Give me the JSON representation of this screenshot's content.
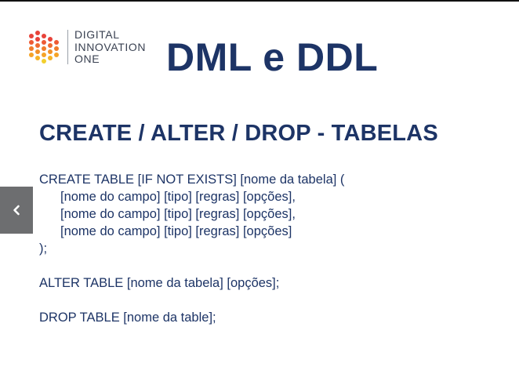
{
  "logo": {
    "lines": [
      "DIGITAL",
      "INNOVATION",
      "ONE"
    ],
    "colors": [
      "#e8433a",
      "#f07b2a",
      "#f5b226",
      "#f2cf2d"
    ]
  },
  "slide": {
    "title": "DML e DDL",
    "heading": "CREATE / ALTER / DROP - TABELAS",
    "create_block": [
      "CREATE TABLE [IF NOT EXISTS] [nome da tabela] (",
      "[nome do campo] [tipo] [regras] [opções],",
      "[nome do campo] [tipo] [regras] [opções],",
      "[nome do campo] [tipo] [regras] [opções]",
      ");"
    ],
    "alter_line": "ALTER TABLE [nome da tabela] [opções];",
    "drop_line": "DROP TABLE [nome da table];",
    "text_color": "#1d3466"
  },
  "navigation": {
    "prev_icon": "chevron-left-icon",
    "button_color": "#6d6e70"
  }
}
